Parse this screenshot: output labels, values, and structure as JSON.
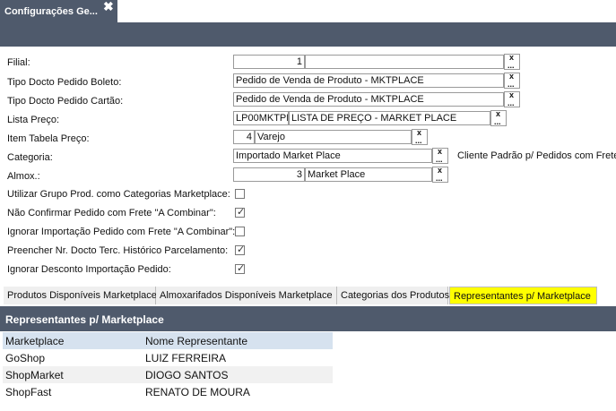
{
  "window": {
    "tab_title": "Configurações Ge...",
    "close_glyph": "✖"
  },
  "form": {
    "filial": {
      "label": "Filial:",
      "code": "1",
      "desc": ""
    },
    "tipo_boleto": {
      "label": "Tipo Docto Pedido Boleto:",
      "value": "Pedido de Venda de Produto - MKTPLACE"
    },
    "tipo_cartao": {
      "label": "Tipo Docto Pedido Cartão:",
      "value": "Pedido de Venda de Produto - MKTPLACE"
    },
    "lista_preco": {
      "label": "Lista Preço:",
      "code": "LP00MKTPL",
      "desc": "LISTA DE PREÇO - MARKET PLACE"
    },
    "item_tabela": {
      "label": "Item Tabela Preço:",
      "code": "4",
      "desc": "Varejo"
    },
    "categoria": {
      "label": "Categoria:",
      "value": "Importado Market Place"
    },
    "cliente_padrao": {
      "label": "Cliente Padrão p/ Pedidos com Frete"
    },
    "almox": {
      "label": "Almox.:",
      "code": "3",
      "desc": "Market Place"
    }
  },
  "checkboxes": [
    {
      "label": "Utilizar Grupo Prod. como Categorias Marketplace:",
      "checked": false
    },
    {
      "label": "Não Confirmar Pedido com Frete \"A Combinar\":",
      "checked": true
    },
    {
      "label": "Ignorar Importação Pedido com Frete \"A Combinar\":",
      "checked": false
    },
    {
      "label": "Preencher Nr. Docto Terc. Histórico Parcelamento:",
      "checked": true
    },
    {
      "label": "Ignorar Desconto Importação Pedido:",
      "checked": true
    }
  ],
  "picker": {
    "clear_glyph": "x",
    "dots_glyph": "..."
  },
  "subtabs": [
    {
      "label": "Produtos Disponíveis Marketplace"
    },
    {
      "label": "Almoxarifados Disponíveis Marketplace"
    },
    {
      "label": "Categorias dos Produtos"
    },
    {
      "label": "Representantes p/ Marketplace"
    }
  ],
  "grid": {
    "title": "Representantes p/ Marketplace",
    "columns": [
      "Marketplace",
      "Nome Representante"
    ],
    "rows": [
      [
        "GoShop",
        "LUIZ FERREIRA"
      ],
      [
        "ShopMarket",
        "DIOGO SANTOS"
      ],
      [
        "ShopFast",
        "RENATO DE MOURA"
      ]
    ]
  },
  "colors": {
    "header_band": "#4f5a6c",
    "active_tab": "#ffff00",
    "grid_header": "#d6e2ef"
  }
}
